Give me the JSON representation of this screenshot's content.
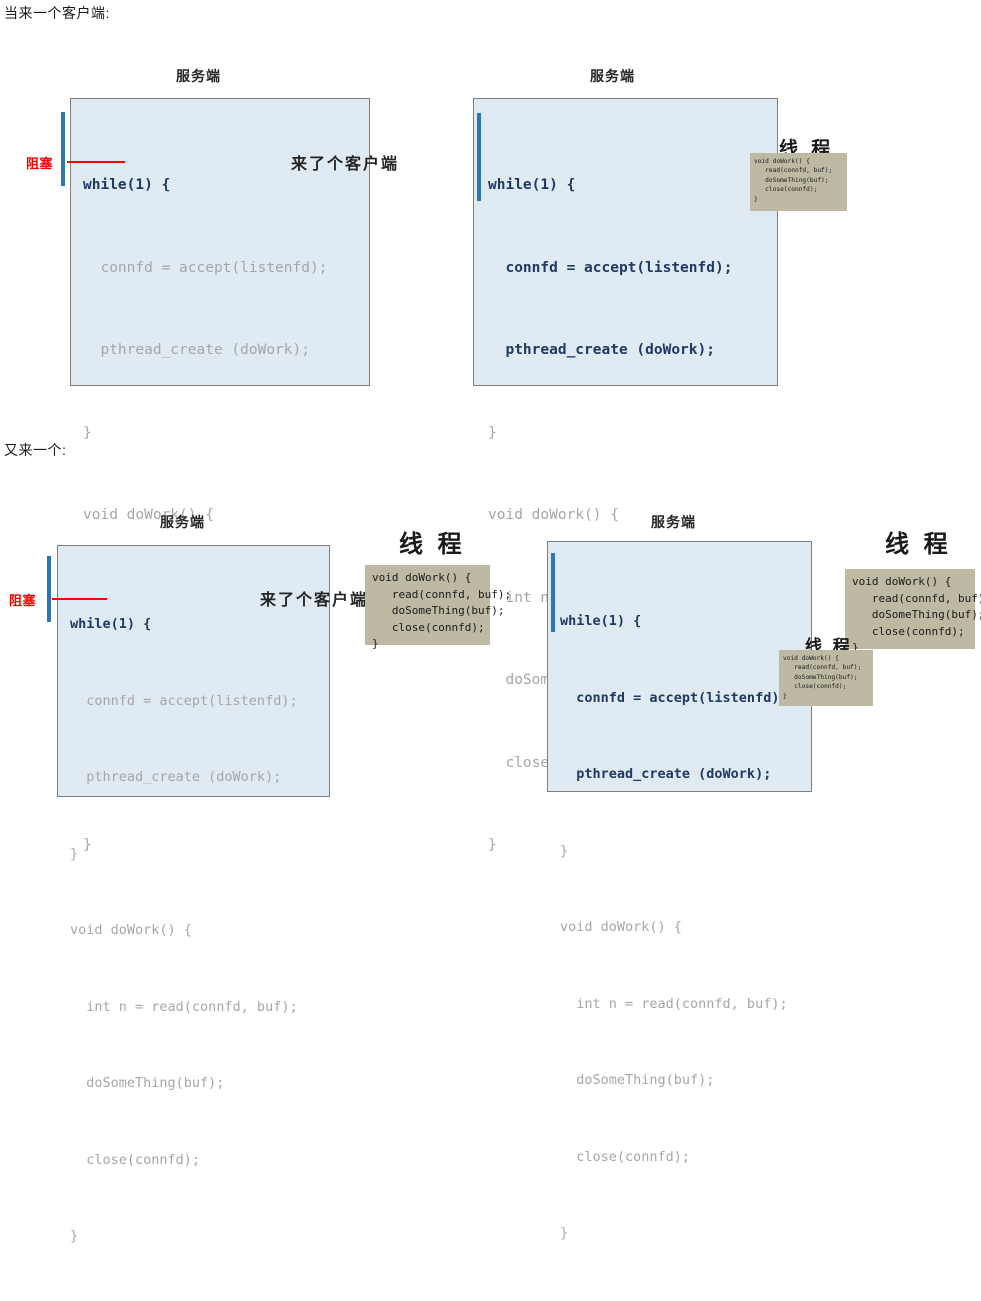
{
  "captions": {
    "first": "当来一个客户端:",
    "second": "又来一个:"
  },
  "labels": {
    "server_title": "服务端",
    "thread_title": "线 程",
    "blocked": "阻塞",
    "client_arrived": "来了个客户端"
  },
  "colors": {
    "code_box_fill": "#dfeaf2",
    "code_box_border": "#7f7f7f",
    "highlight_text": "#1f3864",
    "dim_text": "#a6a6a6",
    "blue_bar": "#2e75b6",
    "red_accent": "#ff0000",
    "thread_box_fill": "#bdb9a2",
    "title_text": "#262626"
  },
  "server_code": {
    "lines": [
      {
        "text": "while(1) {",
        "style": "hl"
      },
      {
        "text": "  connfd = accept(listenfd);",
        "style": "hl"
      },
      {
        "text": "  pthread_create (doWork);",
        "style": "hl"
      },
      {
        "text": "}",
        "style": "dim"
      },
      {
        "text": "void doWork() {",
        "style": "dim"
      },
      {
        "text": "  int n = read(connfd, buf);",
        "style": "dim"
      },
      {
        "text": "  doSomeThing(buf);",
        "style": "dim"
      },
      {
        "text": "  close(connfd);",
        "style": "dim"
      },
      {
        "text": "}",
        "style": "dim"
      }
    ],
    "blocked_lines": [
      {
        "text": "while(1) {",
        "style": "hl"
      },
      {
        "text": "  connfd = accept(listenfd);",
        "style": "dim"
      },
      {
        "text": "  pthread_create (doWork);",
        "style": "dim"
      },
      {
        "text": "}",
        "style": "dim"
      },
      {
        "text": "void doWork() {",
        "style": "dim"
      },
      {
        "text": "  int n = read(connfd, buf);",
        "style": "dim"
      },
      {
        "text": "  doSomeThing(buf);",
        "style": "dim"
      },
      {
        "text": "  close(connfd);",
        "style": "dim"
      },
      {
        "text": "}",
        "style": "dim"
      }
    ]
  },
  "thread_code": {
    "text": "void doWork() {\n   read(connfd, buf);\n   doSomeThing(buf);\n   close(connfd);\n}"
  },
  "panels": [
    {
      "id": "top-left",
      "title": "服务端",
      "state": "blocked",
      "threads": 0
    },
    {
      "id": "top-right",
      "title": "服务端",
      "state": "running",
      "threads": 1
    },
    {
      "id": "bottom-left",
      "title": "服务端",
      "state": "blocked",
      "threads": 1
    },
    {
      "id": "bottom-right",
      "title": "服务端",
      "state": "running",
      "threads": 2
    }
  ]
}
